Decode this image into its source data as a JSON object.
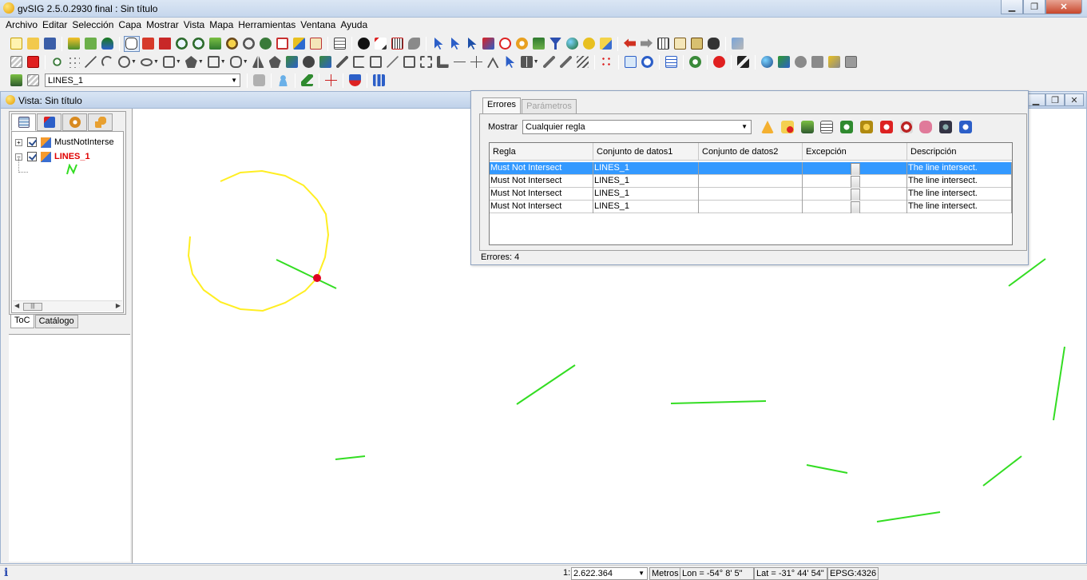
{
  "window": {
    "title": "gvSIG 2.5.0.2930 final : Sin título"
  },
  "menu": [
    "Archivo",
    "Editar",
    "Selección",
    "Capa",
    "Mostrar",
    "Vista",
    "Mapa",
    "Herramientas",
    "Ventana",
    "Ayuda"
  ],
  "toolbar": {
    "layer_selector": "LINES_1"
  },
  "view": {
    "title": "Vista: Sin título"
  },
  "toc": {
    "layers": [
      {
        "name": "MustNotInterse",
        "checked": true
      },
      {
        "name": "LINES_1",
        "checked": true
      }
    ],
    "tabs": [
      "ToC",
      "Catálogo"
    ]
  },
  "errors_panel": {
    "tabs": [
      "Errores",
      "Parámetros"
    ],
    "filter_label": "Mostrar",
    "filter_value": "Cualquier regla",
    "columns": [
      "Regla",
      "Conjunto de datos1",
      "Conjunto de datos2",
      "Excepción",
      "Descripción"
    ],
    "rows": [
      {
        "rule": "Must Not Intersect",
        "dataset1": "LINES_1",
        "dataset2": "",
        "exception": false,
        "description": "The line intersect.",
        "selected": true
      },
      {
        "rule": "Must Not Intersect",
        "dataset1": "LINES_1",
        "dataset2": "",
        "exception": false,
        "description": "The line intersect.",
        "selected": false
      },
      {
        "rule": "Must Not Intersect",
        "dataset1": "LINES_1",
        "dataset2": "",
        "exception": false,
        "description": "The line intersect.",
        "selected": false
      },
      {
        "rule": "Must Not Intersect",
        "dataset1": "LINES_1",
        "dataset2": "",
        "exception": false,
        "description": "The line intersect.",
        "selected": false
      }
    ],
    "count_label": "Errores: 4"
  },
  "status": {
    "scale_prefix": "1:",
    "scale": "2.622.364",
    "units": "Metros",
    "lon": "Lon = -54° 8' 5\"",
    "lat": "Lat = -31° 44' 54\"",
    "epsg": "EPSG:4326"
  },
  "colors": {
    "line_features": "#33dd22",
    "error_geometry": "#ffee22",
    "error_point": "#e00022",
    "selection": "#3399ff"
  }
}
